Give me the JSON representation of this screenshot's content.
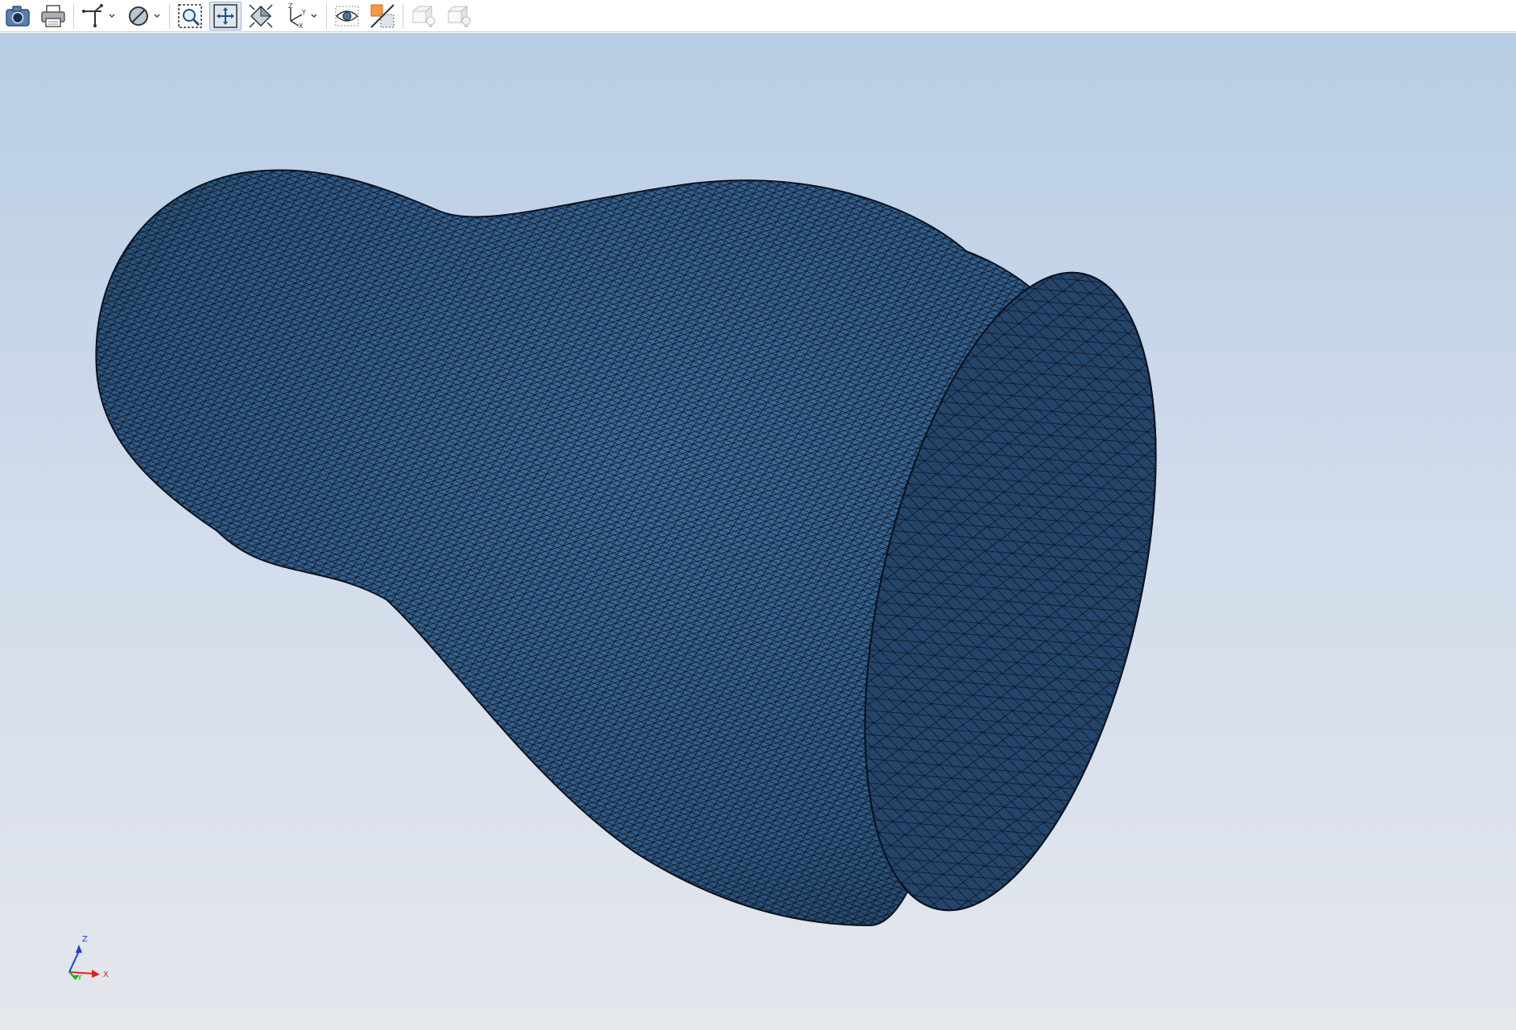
{
  "toolbar": {
    "groups": [
      [
        "camera-icon",
        "print-icon",
        "axis-dropdown-icon",
        "display-mode-icon"
      ],
      [
        "zoom-box-icon",
        "fit-all-icon",
        "view-iso-icon",
        "axis-orientation-icon"
      ],
      [
        "visibility-eye-icon",
        "section-cut-icon",
        "light-box-icon",
        "light-box-icon"
      ]
    ],
    "active": "fit-all-icon"
  },
  "viewport": {
    "background_top": "#b8cde5",
    "background_bottom": "#e4e7ec",
    "mesh_color": "#2f5a85",
    "cap_color": "#24446a",
    "wire_color": "#0a1220"
  },
  "triad": {
    "z_label": "Z",
    "y_label": "Y",
    "x_label": "X",
    "x_color": "#e02020",
    "y_color": "#18b818",
    "z_color": "#1e3cd6"
  }
}
